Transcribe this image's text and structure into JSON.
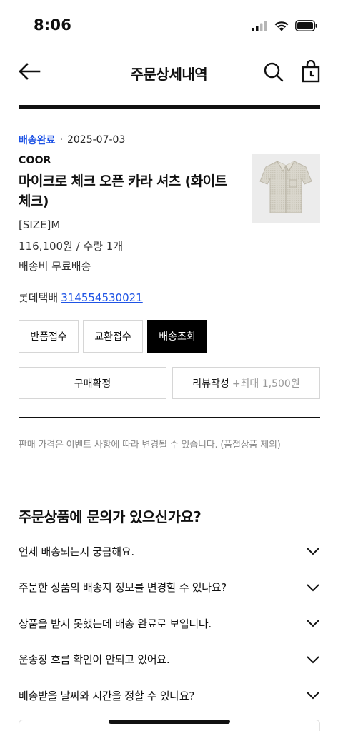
{
  "status_bar": {
    "time": "8:06"
  },
  "header": {
    "title": "주문상세내역",
    "back_icon": "arrow-left-icon",
    "search_icon": "search-icon",
    "bag_icon": "shopping-bag-icon"
  },
  "order": {
    "status": "배송완료",
    "separator": "·",
    "date": "2025-07-03",
    "status_color": "#1e53e5"
  },
  "product": {
    "brand": "COOR",
    "name": "마이크로 체크 오픈 카라 셔츠 (화이트 체크)",
    "size": "[SIZE]M",
    "price_qty": "116,100원 / 수량 1개",
    "shipping": "배송비 무료배송",
    "image_icon": "shirt-image"
  },
  "delivery": {
    "courier": "롯데택배",
    "tracking_number": "314554530021"
  },
  "actions": {
    "return": "반품접수",
    "exchange": "교환접수",
    "track": "배송조회",
    "confirm": "구매확정",
    "review": "리뷰작성",
    "review_bonus": "+최대 1,500원"
  },
  "notice": "판매 가격은 이벤트 사항에 따라 변경될 수 있습니다. (품절상품 제외)",
  "faq": {
    "title": "주문상품에 문의가 있으신가요?",
    "items": [
      {
        "question": "언제 배송되는지 궁금해요."
      },
      {
        "question": "주문한 상품의 배송지 정보를 변경할 수 있나요?"
      },
      {
        "question": "상품을 받지 못했는데 배송 완료로 보입니다."
      },
      {
        "question": "운송장 흐름 확인이 안되고 있어요."
      },
      {
        "question": "배송받을 날짜와 시간을 정할 수 있나요?"
      }
    ],
    "chevron_icon": "chevron-down-icon"
  }
}
